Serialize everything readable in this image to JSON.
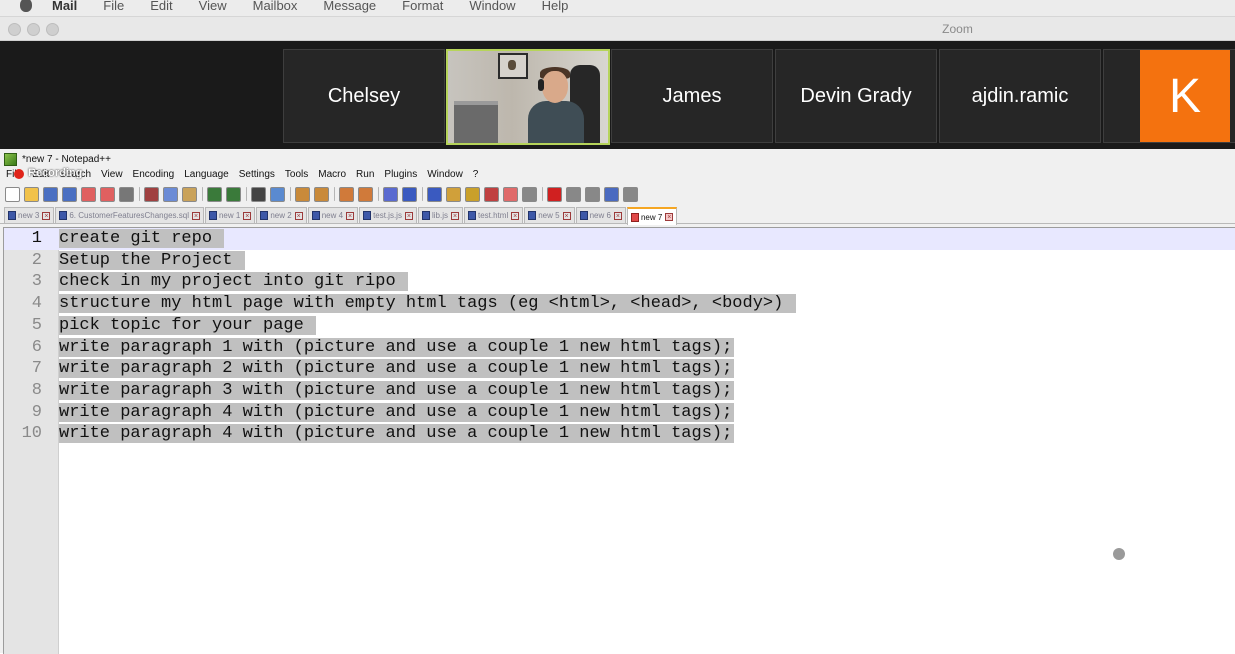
{
  "mac_menu": {
    "app": "Mail",
    "items": [
      "File",
      "Edit",
      "View",
      "Mailbox",
      "Message",
      "Format",
      "Window",
      "Help"
    ]
  },
  "zoom": {
    "window_title": "Zoom",
    "participants": [
      "Chelsey",
      "",
      "James",
      "Devin Grady",
      "ajdin.ramic"
    ],
    "avatar_initial": "K",
    "avatar_color": "#f4720f",
    "active_speaker_border": "#b6d45a"
  },
  "notepad": {
    "title": "*new 7 - Notepad++",
    "recording_label": "Recording",
    "menu": [
      "File",
      "Edit",
      "Search",
      "View",
      "Encoding",
      "Language",
      "Settings",
      "Tools",
      "Macro",
      "Run",
      "Plugins",
      "Window",
      "?"
    ],
    "tabs": [
      {
        "label": "new 3",
        "active": false
      },
      {
        "label": "6. CustomerFeaturesChanges.sql",
        "active": false
      },
      {
        "label": "new 1",
        "active": false
      },
      {
        "label": "new 2",
        "active": false
      },
      {
        "label": "new 4",
        "active": false
      },
      {
        "label": "test.js.js",
        "active": false
      },
      {
        "label": "lib.js",
        "active": false
      },
      {
        "label": "test.html",
        "active": false
      },
      {
        "label": "new 5",
        "active": false
      },
      {
        "label": "new 6",
        "active": false
      },
      {
        "label": "new 7",
        "active": true
      }
    ],
    "lines": [
      "create git repo ",
      "Setup the Project ",
      "check in my project into git ripo ",
      "structure my html page with empty html tags (eg <html>, <head>, <body>) ",
      "pick topic for your page ",
      "write paragraph 1 with (picture and use a couple 1 new html tags);",
      "write paragraph 2 with (picture and use a couple 1 new html tags);",
      "write paragraph 3 with (picture and use a couple 1 new html tags);",
      "write paragraph 4 with (picture and use a couple 1 new html tags);",
      "write paragraph 4 with (picture and use a couple 1 new html tags);"
    ],
    "current_line": 1
  }
}
